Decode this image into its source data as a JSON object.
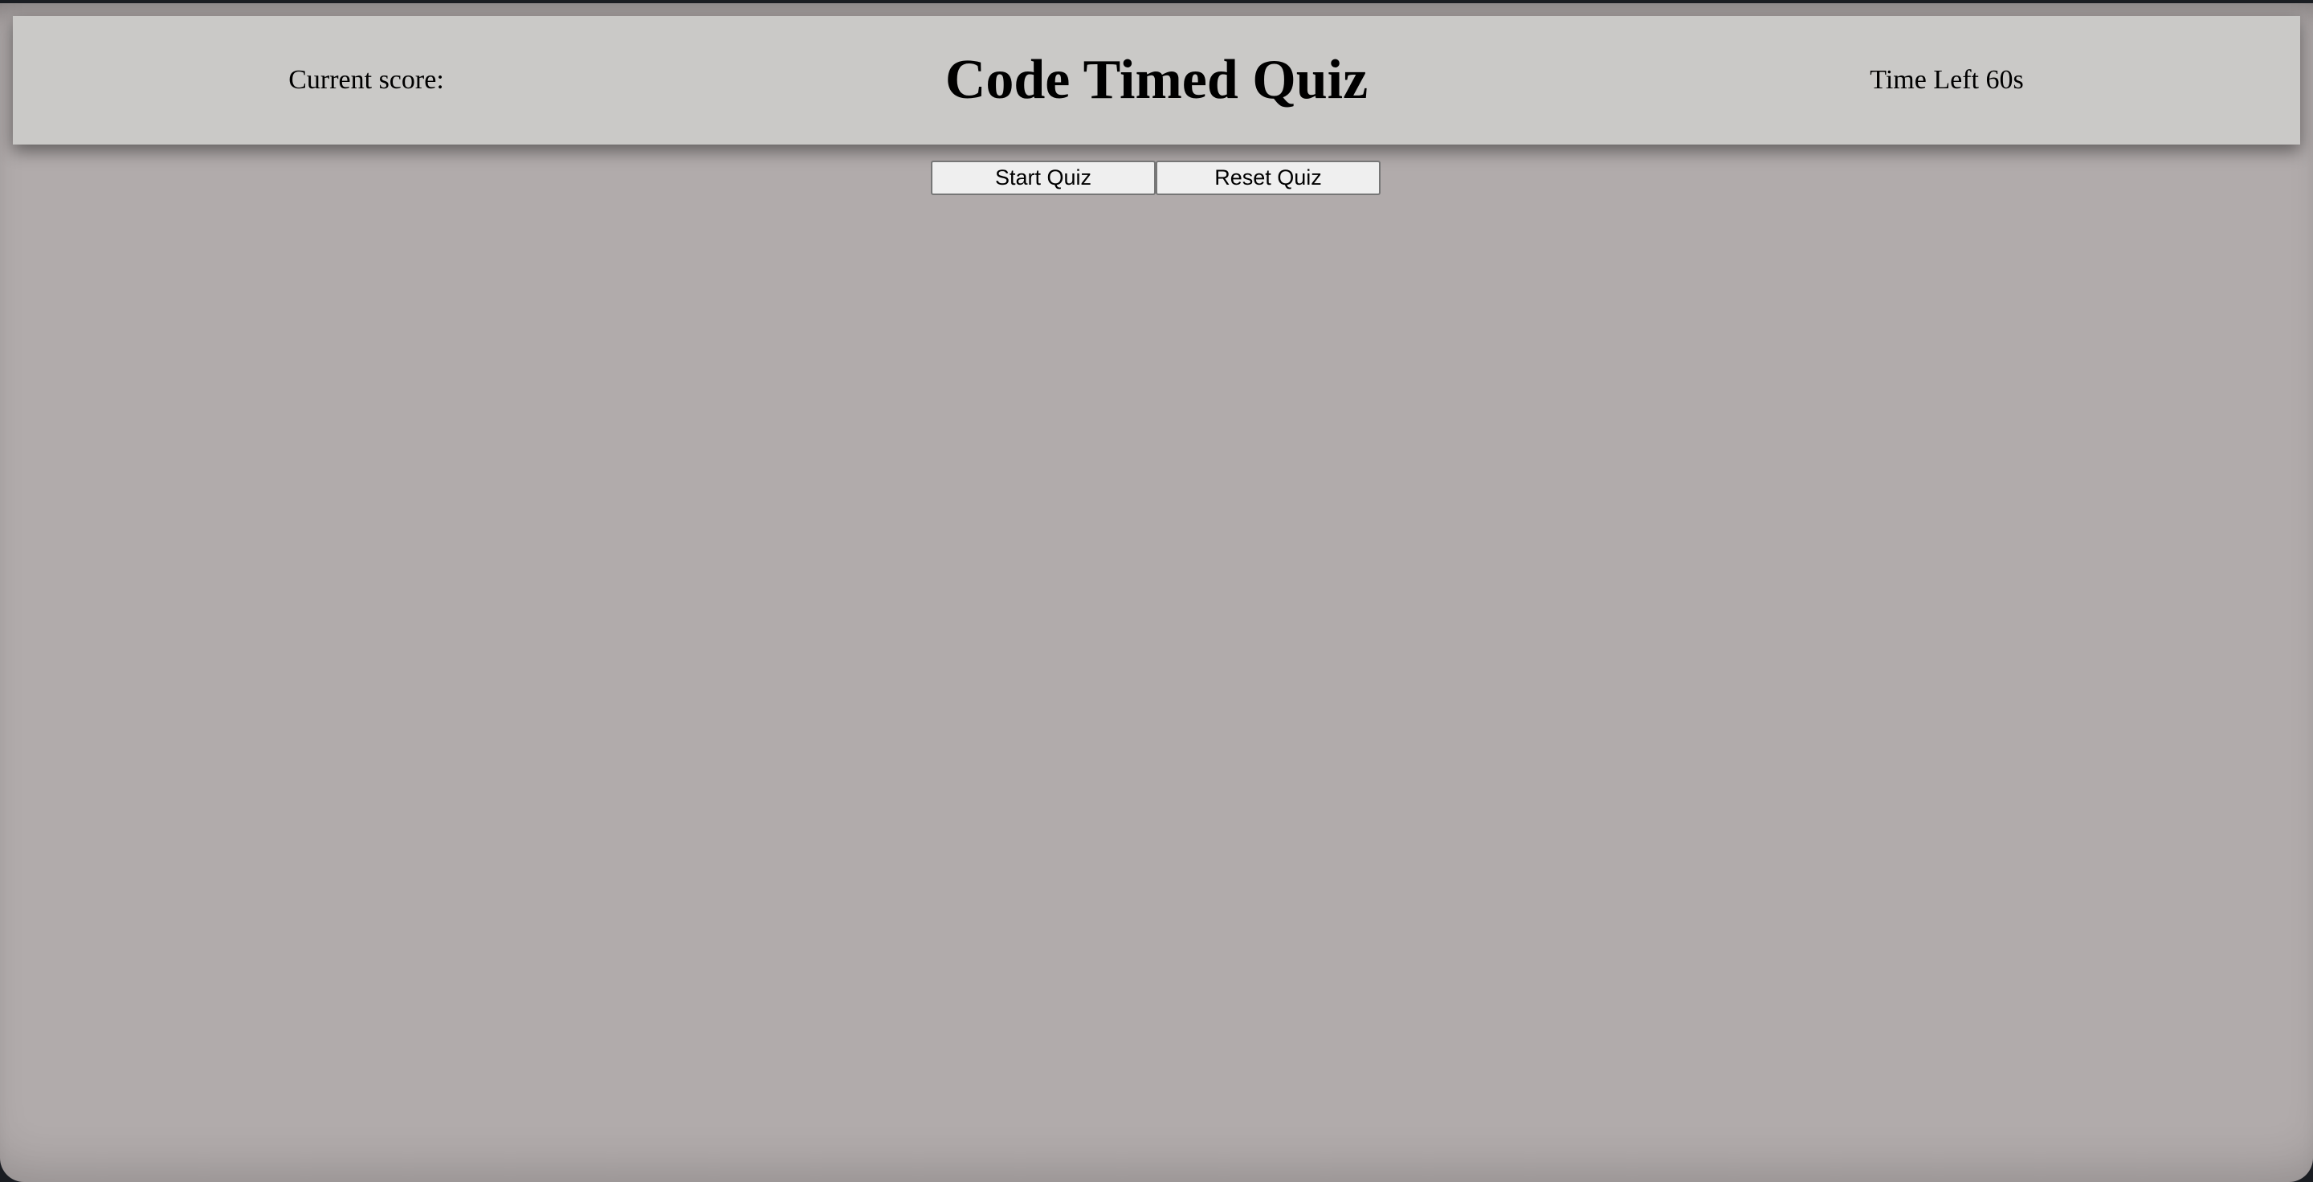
{
  "header": {
    "score_label": "Current score:",
    "title": "Code Timed Quiz",
    "timer_label": "Time Left 60s"
  },
  "controls": {
    "start_label": "Start Quiz",
    "reset_label": "Reset Quiz"
  }
}
